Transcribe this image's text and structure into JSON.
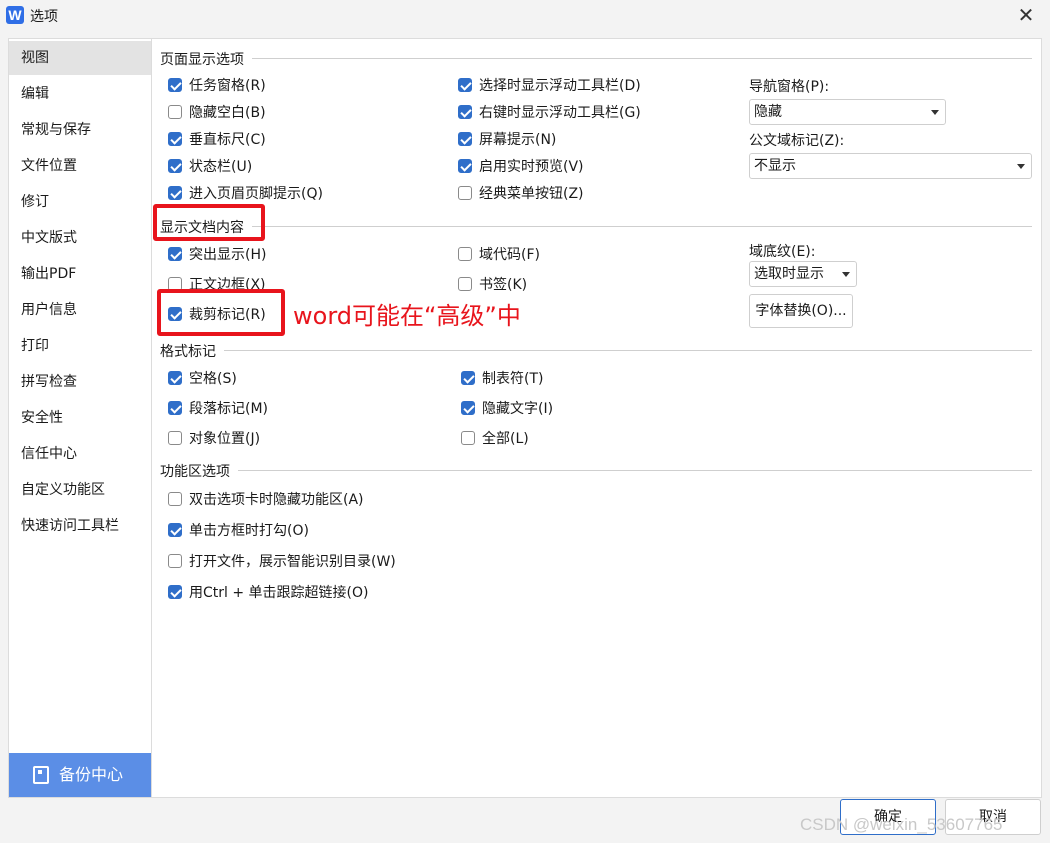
{
  "window": {
    "logo_letter": "W",
    "title": "选项",
    "close_glyph": "✕"
  },
  "sidebar": {
    "items": [
      {
        "label": "视图",
        "active": true
      },
      {
        "label": "编辑"
      },
      {
        "label": "常规与保存"
      },
      {
        "label": "文件位置"
      },
      {
        "label": "修订"
      },
      {
        "label": "中文版式"
      },
      {
        "label": "输出PDF"
      },
      {
        "label": "用户信息"
      },
      {
        "label": "打印"
      },
      {
        "label": "拼写检查"
      },
      {
        "label": "安全性"
      },
      {
        "label": "信任中心"
      },
      {
        "label": "自定义功能区"
      },
      {
        "label": "快速访问工具栏"
      }
    ],
    "backup_label": "备份中心"
  },
  "page_display": {
    "title": "页面显示选项",
    "col1": [
      {
        "label": "任务窗格(R)",
        "checked": true
      },
      {
        "label": "隐藏空白(B)",
        "checked": false
      },
      {
        "label": "垂直标尺(C)",
        "checked": true
      },
      {
        "label": "状态栏(U)",
        "checked": true
      },
      {
        "label": "进入页眉页脚提示(Q)",
        "checked": true
      }
    ],
    "col2": [
      {
        "label": "选择时显示浮动工具栏(D)",
        "checked": true
      },
      {
        "label": "右键时显示浮动工具栏(G)",
        "checked": true
      },
      {
        "label": "屏幕提示(N)",
        "checked": true
      },
      {
        "label": "启用实时预览(V)",
        "checked": true
      },
      {
        "label": "经典菜单按钮(Z)",
        "checked": false
      }
    ],
    "nav_pane_label": "导航窗格(P):",
    "nav_pane_value": "隐藏",
    "field_mark_label": "公文域标记(Z):",
    "field_mark_value": "不显示"
  },
  "doc_content": {
    "title": "显示文档内容",
    "col1": [
      {
        "label": "突出显示(H)",
        "checked": true
      },
      {
        "label": "正文边框(X)",
        "checked": false
      },
      {
        "label": "裁剪标记(R)",
        "checked": true
      }
    ],
    "col2": [
      {
        "label": "域代码(F)",
        "checked": false
      },
      {
        "label": "书签(K)",
        "checked": false
      }
    ],
    "field_shading_label": "域底纹(E):",
    "field_shading_value": "选取时显示",
    "font_sub_button": "字体替换(O)..."
  },
  "format_marks": {
    "title": "格式标记",
    "col1": [
      {
        "label": "空格(S)",
        "checked": true
      },
      {
        "label": "段落标记(M)",
        "checked": true
      },
      {
        "label": "对象位置(J)",
        "checked": false
      }
    ],
    "col2": [
      {
        "label": "制表符(T)",
        "checked": true
      },
      {
        "label": "隐藏文字(I)",
        "checked": true
      },
      {
        "label": "全部(L)",
        "checked": false
      }
    ]
  },
  "ribbon": {
    "title": "功能区选项",
    "items": [
      {
        "label": "双击选项卡时隐藏功能区(A)",
        "checked": false
      },
      {
        "label": "单击方框时打勾(O)",
        "checked": true
      },
      {
        "label": "打开文件，展示智能识别目录(W)",
        "checked": false
      },
      {
        "label": "用Ctrl + 单击跟踪超链接(O)",
        "checked": true
      }
    ]
  },
  "annotation": {
    "text": "word可能在“高级”中",
    "color": "#e8141c"
  },
  "footer": {
    "ok": "确定",
    "cancel": "取消"
  },
  "watermark": "CSDN @weixin_53607765",
  "colors": {
    "accent": "#2f6ec9",
    "backup_bg": "#5b8ee6",
    "highlight": "#e8141c"
  }
}
